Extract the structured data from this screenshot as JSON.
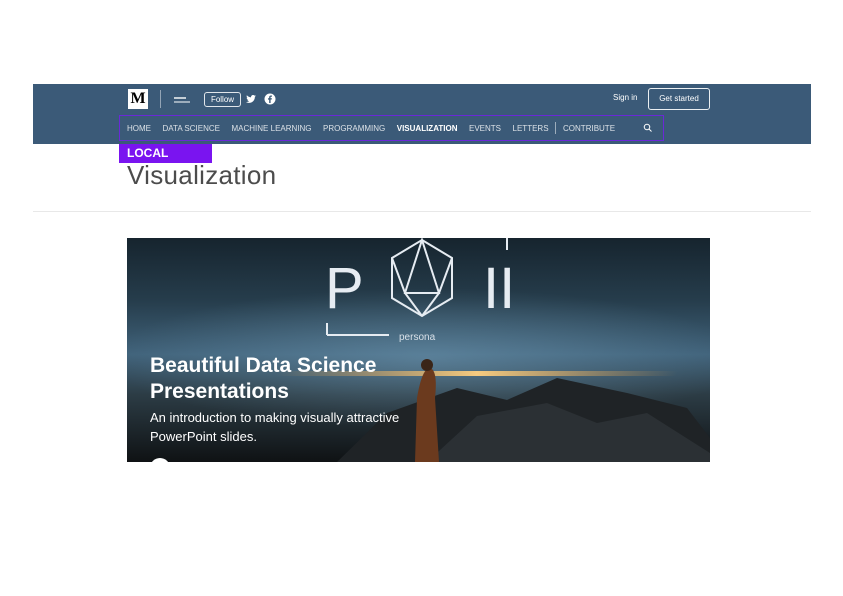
{
  "header": {
    "logo_text": "M",
    "follow_label": "Follow",
    "signin_label": "Sign in",
    "get_started_label": "Get started",
    "bg_color": "#3b5a78"
  },
  "nav": {
    "items": [
      {
        "label": "HOME",
        "active": false
      },
      {
        "label": "DATA SCIENCE",
        "active": false
      },
      {
        "label": "MACHINE LEARNING",
        "active": false
      },
      {
        "label": "PROGRAMMING",
        "active": false
      },
      {
        "label": "VISUALIZATION",
        "active": true
      },
      {
        "label": "EVENTS",
        "active": false
      },
      {
        "label": "LETTERS",
        "active": false
      },
      {
        "label": "CONTRIBUTE",
        "active": false
      }
    ],
    "icons": [
      "twitter-icon",
      "facebook-icon",
      "search-icon"
    ]
  },
  "badge": {
    "label": "LOCAL",
    "color": "#7a14f0"
  },
  "page": {
    "title": "Visualization"
  },
  "featured": {
    "logo_letter_left": "P",
    "logo_letter_right": "II",
    "logo_caption": "persona",
    "title_line1": "Beautiful Data Science",
    "title_line2": "Presentations",
    "subtitle_line1": "An introduction to making visually attractive",
    "subtitle_line2": "PowerPoint slides."
  }
}
